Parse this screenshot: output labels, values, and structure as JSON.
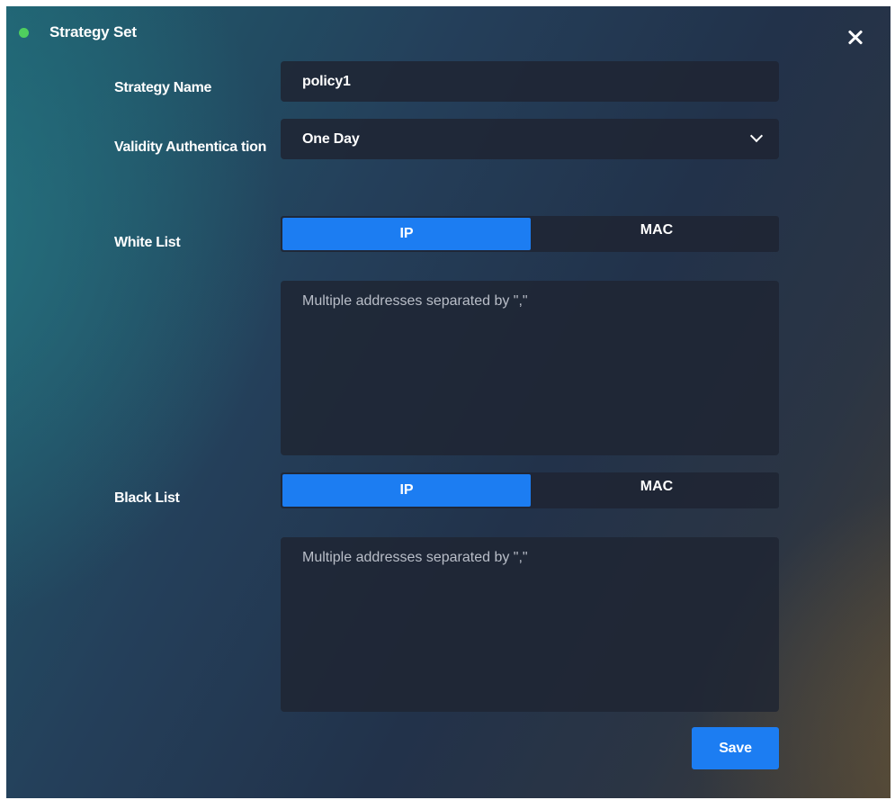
{
  "dialog": {
    "title": "Strategy Set",
    "status_color": "#4fcf5e",
    "close_icon": "close-icon"
  },
  "form": {
    "strategy_name": {
      "label": "Strategy Name",
      "value": "policy1"
    },
    "validity": {
      "label": "Validity Authentica tion",
      "selected": "One Day",
      "icon": "chevron-down-icon"
    },
    "white_list": {
      "label": "White List",
      "options": [
        "IP",
        "MAC"
      ],
      "selected": "IP",
      "placeholder": "Multiple addresses separated by \",\""
    },
    "black_list": {
      "label": "Black List",
      "options": [
        "IP",
        "MAC"
      ],
      "selected": "IP",
      "placeholder": "Multiple addresses separated by \",\""
    }
  },
  "actions": {
    "save_label": "Save"
  },
  "colors": {
    "accent": "#1c7df2"
  }
}
